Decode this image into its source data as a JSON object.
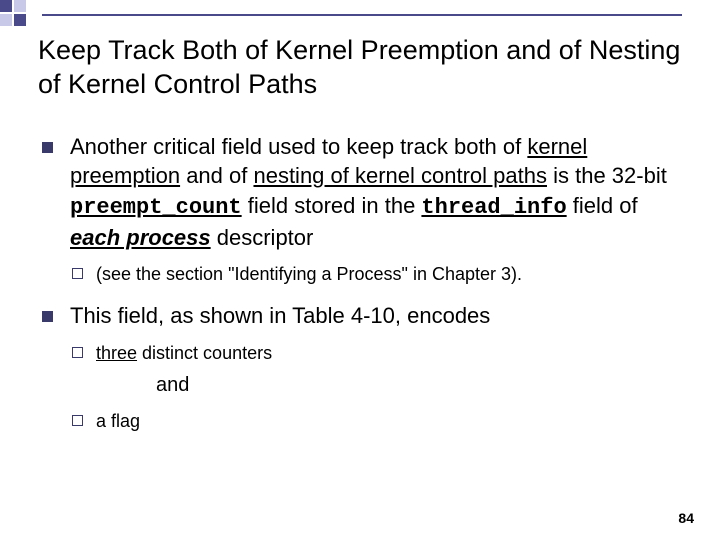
{
  "title": "Keep Track Both of Kernel Preemption and of Nesting of Kernel Control Paths",
  "b1": {
    "pre": "Another critical field used to keep track both of ",
    "u1": "kernel preemption",
    "mid1": " and of ",
    "u2": "nesting of kernel control paths",
    "mid2": " is the 32-bit ",
    "code1": "preempt_count",
    "mid3": " field stored in the ",
    "code2": "thread_info",
    "mid4": " field of ",
    "bi": "each process",
    "post": " descriptor",
    "sub": "(see the section \"Identifying a Process\" in Chapter 3)."
  },
  "b2": {
    "text": "This field, as shown in Table 4-10, encodes",
    "s1a": "three",
    "s1b": " distinct counters",
    "and": "and",
    "s2": "a flag"
  },
  "page": "84"
}
